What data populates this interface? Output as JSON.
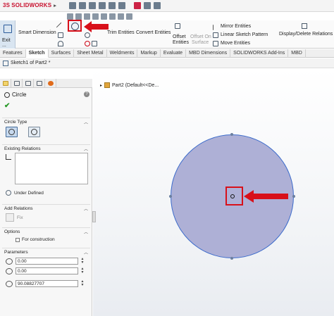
{
  "app": {
    "brand": "SOLIDWORKS",
    "brand_prefix": "3S"
  },
  "command_manager": {
    "exit_label": "Exit ...",
    "smart_dimension": "Smart Dimension",
    "trim_entities": "Trim Entities",
    "convert_entities": "Convert Entities",
    "offset_entities_line1": "Offset",
    "offset_entities_line2": "Entities",
    "offset_on_surface_line1": "Offset On",
    "offset_on_surface_line2": "Surface",
    "mirror_entities": "Mirror Entities",
    "linear_sketch_pattern": "Linear Sketch Pattern",
    "move_entities": "Move Entities",
    "display_delete_relations": "Display/Delete Relations"
  },
  "tabs": [
    {
      "label": "Features"
    },
    {
      "label": "Sketch",
      "active": true
    },
    {
      "label": "Surfaces"
    },
    {
      "label": "Sheet Metal"
    },
    {
      "label": "Weldments"
    },
    {
      "label": "Markup"
    },
    {
      "label": "Evaluate"
    },
    {
      "label": "MBD Dimensions"
    },
    {
      "label": "SOLIDWORKS Add-Ins"
    },
    {
      "label": "MBD"
    }
  ],
  "tree_header": {
    "label": "Sketch1 of Part2 *"
  },
  "graphics": {
    "tree_node": "Part2  (Default<<De..."
  },
  "property_manager": {
    "title": "Circle",
    "help": "?",
    "circle_type": {
      "header": "Circle Type"
    },
    "existing_relations": {
      "header": "Existing Relations",
      "status": "Under Defined"
    },
    "add_relations": {
      "header": "Add Relations",
      "fix_label": "Fix"
    },
    "options": {
      "header": "Options",
      "for_construction": "For construction",
      "for_construction_checked": false
    },
    "parameters": {
      "header": "Parameters",
      "cx": "0.00",
      "cy": "0.00",
      "radius": "90.08827707"
    }
  },
  "colors": {
    "highlight_red": "#d8101a",
    "circle_fill": "#aeb0d6",
    "circle_stroke": "#3a6acb",
    "brand_red": "#c8102e"
  }
}
